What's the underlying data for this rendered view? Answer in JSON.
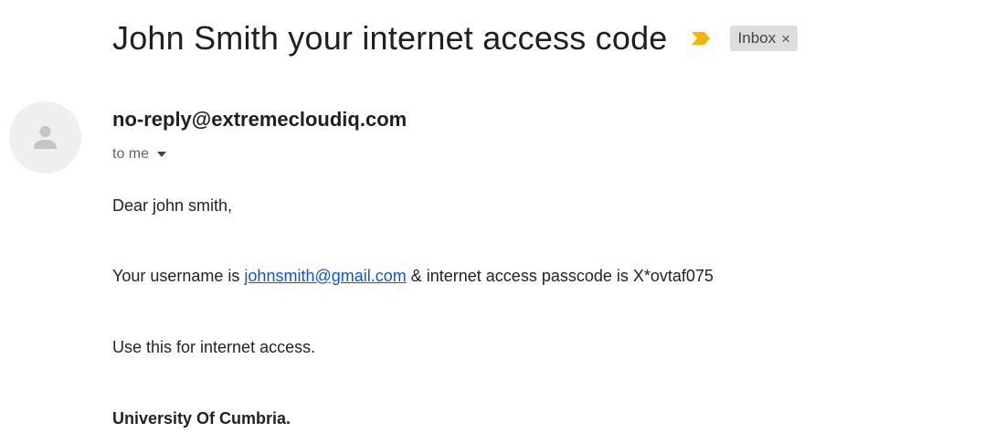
{
  "email": {
    "subject": "John Smith your internet access code",
    "label": "Inbox",
    "label_close": "×",
    "sender": "no-reply@extremecloudiq.com",
    "recipient": "to me",
    "body": {
      "greeting": "Dear john smith,",
      "username_prefix": "Your username is ",
      "username_link": "johnsmith@gmail.com",
      "passcode_text": " & internet access passcode is X*ovtaf075",
      "instruction": "Use this for internet access.",
      "signature": "University Of Cumbria."
    }
  },
  "colors": {
    "importance_marker": "#f4b400",
    "link": "#1155cc",
    "label_chip_bg": "#dddddd",
    "avatar_bg": "#efefef",
    "avatar_icon": "#c5c5c5"
  },
  "icons": {
    "importance": "importance-marker-icon",
    "avatar": "person-icon",
    "recipient_details": "caret-down-icon",
    "label_remove": "close-icon"
  }
}
